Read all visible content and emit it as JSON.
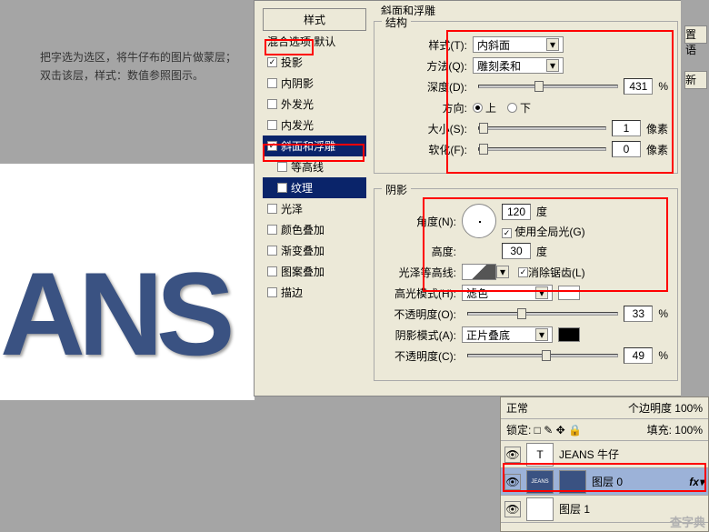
{
  "bg_text_line1": "把字选为选区，将牛仔布的图片做蒙层；",
  "bg_text_line2": "双击该层，样式：数值参照图示。",
  "bg_jeans": "ANS",
  "dialog": {
    "styles_header": "样式",
    "items": {
      "blend": "混合选项:默认",
      "drop_shadow": "投影",
      "inner_shadow": "内阴影",
      "outer_glow": "外发光",
      "inner_glow": "内发光",
      "bevel": "斜面和浮雕",
      "contour": "等高线",
      "texture": "纹理",
      "satin": "光泽",
      "color_overlay": "颜色叠加",
      "gradient_overlay": "渐变叠加",
      "pattern_overlay": "图案叠加",
      "stroke": "描边"
    }
  },
  "panel": {
    "title": "斜面和浮雕",
    "structure": {
      "legend": "结构",
      "style_label": "样式(T):",
      "style_value": "内斜面",
      "method_label": "方法(Q):",
      "method_value": "雕刻柔和",
      "depth_label": "深度(D):",
      "depth_value": "431",
      "depth_unit": "%",
      "direction_label": "方向:",
      "dir_up": "上",
      "dir_down": "下",
      "size_label": "大小(S):",
      "size_value": "1",
      "size_unit": "像素",
      "soften_label": "软化(F):",
      "soften_value": "0",
      "soften_unit": "像素"
    },
    "shading": {
      "legend": "阴影",
      "angle_label": "角度(N):",
      "angle_value": "120",
      "angle_unit": "度",
      "global_light": "使用全局光(G)",
      "altitude_label": "高度:",
      "altitude_value": "30",
      "altitude_unit": "度",
      "gloss_label": "光泽等高线:",
      "antialias": "消除锯齿(L)",
      "highlight_mode_label": "高光模式(H):",
      "highlight_mode_value": "滤色",
      "opacity_label": "不透明度(O):",
      "opacity_value": "33",
      "opacity_unit": "%",
      "shadow_mode_label": "阴影模式(A):",
      "shadow_mode_value": "正片叠底",
      "opacity2_label": "不透明度(C):",
      "opacity2_value": "49",
      "opacity2_unit": "%"
    },
    "btn_lang": "置语",
    "btn_new": "新"
  },
  "layers": {
    "normal": "正常",
    "opacity_label": "个边明度",
    "opacity_value": "100%",
    "lock_label": "锁定:",
    "fill_label": "填充:",
    "fill_value": "100%",
    "layer_text": "JEANS 牛仔",
    "layer0": "图层 0",
    "layer1": "图层 1"
  },
  "watermark": "查字典"
}
